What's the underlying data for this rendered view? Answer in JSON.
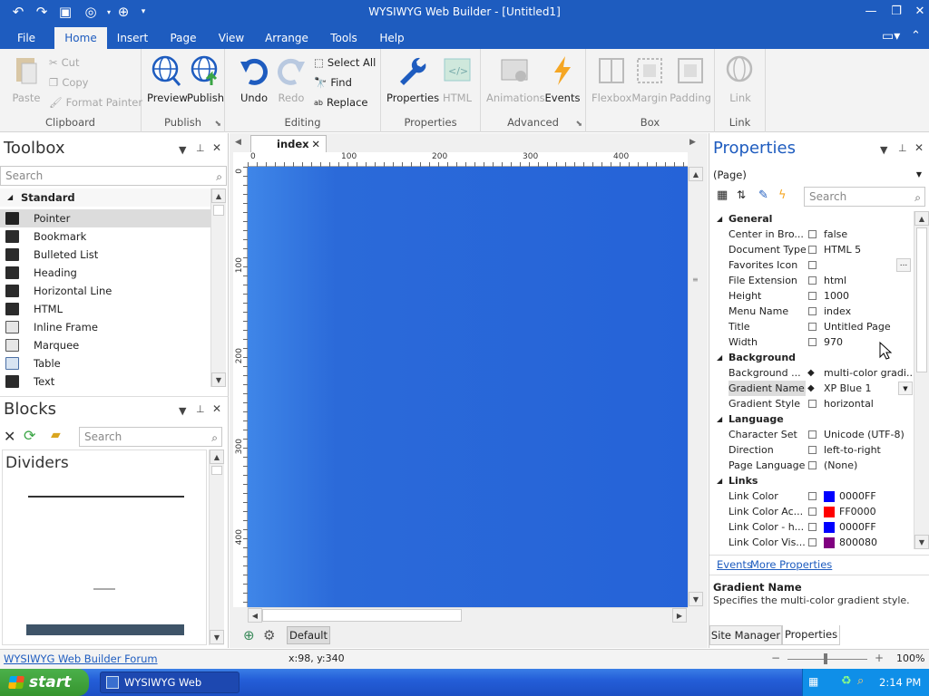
{
  "title_bar": {
    "title": "WYSIWYG Web Builder - [Untitled1]"
  },
  "ribbon_tabs": [
    "File",
    "Home",
    "Insert",
    "Page",
    "View",
    "Arrange",
    "Tools",
    "Help"
  ],
  "ribbon": {
    "clipboard": {
      "label": "Clipboard",
      "paste": "Paste",
      "cut": "Cut",
      "copy": "Copy",
      "format_painter": "Format Painter"
    },
    "publish": {
      "label": "Publish",
      "preview": "Preview",
      "publish": "Publish"
    },
    "editing": {
      "label": "Editing",
      "undo": "Undo",
      "redo": "Redo",
      "select_all": "Select All",
      "find": "Find",
      "replace": "Replace"
    },
    "properties": {
      "label": "Properties",
      "properties": "Properties",
      "html": "HTML"
    },
    "advanced": {
      "label": "Advanced",
      "animations": "Animations",
      "events": "Events"
    },
    "box": {
      "label": "Box",
      "flexbox": "Flexbox",
      "margin": "Margin",
      "padding": "Padding"
    },
    "link": {
      "label": "Link",
      "link": "Link"
    }
  },
  "toolbox": {
    "title": "Toolbox",
    "search_placeholder": "Search",
    "category": "Standard",
    "items": [
      "Pointer",
      "Bookmark",
      "Bulleted List",
      "Heading",
      "Horizontal Line",
      "HTML",
      "Inline Frame",
      "Marquee",
      "Table",
      "Text"
    ]
  },
  "blocks": {
    "title": "Blocks",
    "search_placeholder": "Search",
    "section": "Dividers"
  },
  "editor": {
    "tab": "index",
    "ruler_top": [
      "0",
      "100",
      "200",
      "300",
      "400"
    ],
    "ruler_left": [
      "0",
      "100",
      "200",
      "300",
      "400"
    ],
    "page_tab": "Default"
  },
  "properties": {
    "title": "Properties",
    "object": "(Page)",
    "search_placeholder": "Search",
    "categories": {
      "general": "General",
      "general_rows": [
        {
          "name": "Center in Bro...",
          "value": "false"
        },
        {
          "name": "Document Type",
          "value": "HTML 5"
        },
        {
          "name": "Favorites Icon",
          "value": ""
        },
        {
          "name": "File Extension",
          "value": "html"
        },
        {
          "name": "Height",
          "value": "1000"
        },
        {
          "name": "Menu Name",
          "value": "index"
        },
        {
          "name": "Title",
          "value": "Untitled Page"
        },
        {
          "name": "Width",
          "value": "970"
        }
      ],
      "background": "Background",
      "background_rows": [
        {
          "name": "Background ...",
          "value": "multi-color gradi..."
        },
        {
          "name": "Gradient Name",
          "value": "XP Blue 1"
        },
        {
          "name": "Gradient Style",
          "value": "horizontal"
        }
      ],
      "language": "Language",
      "language_rows": [
        {
          "name": "Character Set",
          "value": "Unicode (UTF-8)"
        },
        {
          "name": "Direction",
          "value": "left-to-right"
        },
        {
          "name": "Page Language",
          "value": "(None)"
        }
      ],
      "links": "Links",
      "link_rows": [
        {
          "name": "Link Color",
          "value": "0000FF",
          "color": "#0000FF"
        },
        {
          "name": "Link Color Ac...",
          "value": "FF0000",
          "color": "#FF0000"
        },
        {
          "name": "Link Color - h...",
          "value": "0000FF",
          "color": "#0000FF"
        },
        {
          "name": "Link Color Vis...",
          "value": "800080",
          "color": "#800080"
        }
      ]
    },
    "events_link": "Events",
    "more_link": "More Properties",
    "desc_title": "Gradient Name",
    "desc_text": "Specifies the multi-color gradient style.",
    "bottom_tabs": [
      "Site Manager",
      "Properties"
    ]
  },
  "status": {
    "forum_link": "WYSIWYG Web Builder Forum",
    "coords": "x:98, y:340",
    "zoom": "100%"
  },
  "taskbar": {
    "start": "start",
    "window": "WYSIWYG Web Build...",
    "time": "2:14 PM"
  },
  "colors": {
    "accent": "#1e5cbf",
    "canvas": "#2563d8"
  }
}
